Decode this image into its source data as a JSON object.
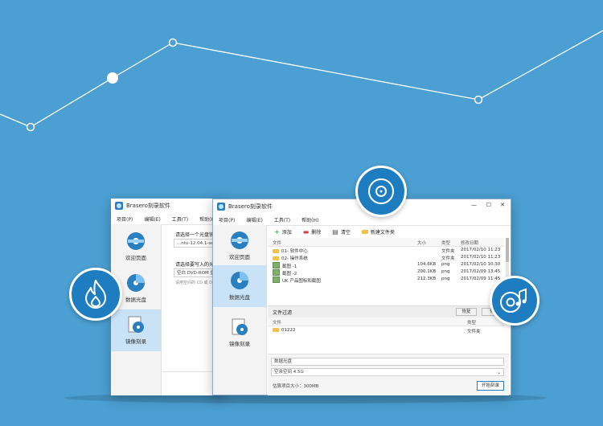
{
  "theme": {
    "background": "#4b9fd2",
    "badge": "#1e7dc0",
    "accent": "#c9e2f6"
  },
  "back_window": {
    "title": "Brasero刻录软件",
    "menu": [
      "项目(P)",
      "编辑(E)",
      "工具(T)",
      "帮助(H)"
    ],
    "sidebar": [
      {
        "label": "欢迎页面",
        "icon": "welcome-icon"
      },
      {
        "label": "数据光盘",
        "icon": "data-disc-icon"
      },
      {
        "label": "镜像刻录",
        "icon": "image-burn-icon"
      }
    ],
    "prompt1": "请选择一个光盘镜",
    "iso_field": "...ntu-12.04.1-serve",
    "prompt2": "请选择要写入的光",
    "drive_field": "空白 DVD-ROM 盘",
    "hint": "请用空间的 CD 或 D"
  },
  "front_window": {
    "title": "Brasero刻录软件",
    "controls": {
      "minimize": "—",
      "maximize": "☐",
      "close": "✕"
    },
    "menu": [
      "项目(P)",
      "编辑(E)",
      "工具(T)",
      "帮助(H)"
    ],
    "sidebar": [
      {
        "label": "欢迎页面",
        "icon": "welcome-icon"
      },
      {
        "label": "数据光盘",
        "icon": "data-disc-icon"
      },
      {
        "label": "镜像刻录",
        "icon": "image-burn-icon"
      }
    ],
    "toolbar": {
      "add": "添加",
      "delete": "删除",
      "clear": "清空",
      "new_folder": "新建文件夹"
    },
    "files_header": {
      "name": "文件",
      "size": "大小",
      "type": "类型",
      "modified": "修改日期"
    },
    "files": [
      {
        "name": "01- 软件中心",
        "size": "",
        "type": "文件夹",
        "modified": "2017/02/10 11:23",
        "kind": "folder"
      },
      {
        "name": "02- 操作系统",
        "size": "",
        "type": "文件夹",
        "modified": "2017/02/10 11:23",
        "kind": "folder"
      },
      {
        "name": "截图 -1",
        "size": "104.6KB",
        "type": "png",
        "modified": "2017/02/10 10:30",
        "kind": "image"
      },
      {
        "name": "截图 -2",
        "size": "200.1KB",
        "type": "png",
        "modified": "2017/02/09 13:45",
        "kind": "image"
      },
      {
        "name": "UK 产品图标和截图",
        "size": "212.3KB",
        "type": "png",
        "modified": "2017/02/09 11:45",
        "kind": "image"
      }
    ],
    "filter_title": "文件过滤",
    "filter_buttons": {
      "restore": "恢复",
      "other": "恢"
    },
    "filter_header": {
      "name": "文件",
      "type": "类型"
    },
    "filter_rows": [
      {
        "name": "01222",
        "type": "文件夹"
      }
    ],
    "disc_label": "数据光盘",
    "disc_select": "空余空间 4.5G",
    "estimate": "估算项目大小：300MB",
    "burn_button": "开始刻录"
  }
}
